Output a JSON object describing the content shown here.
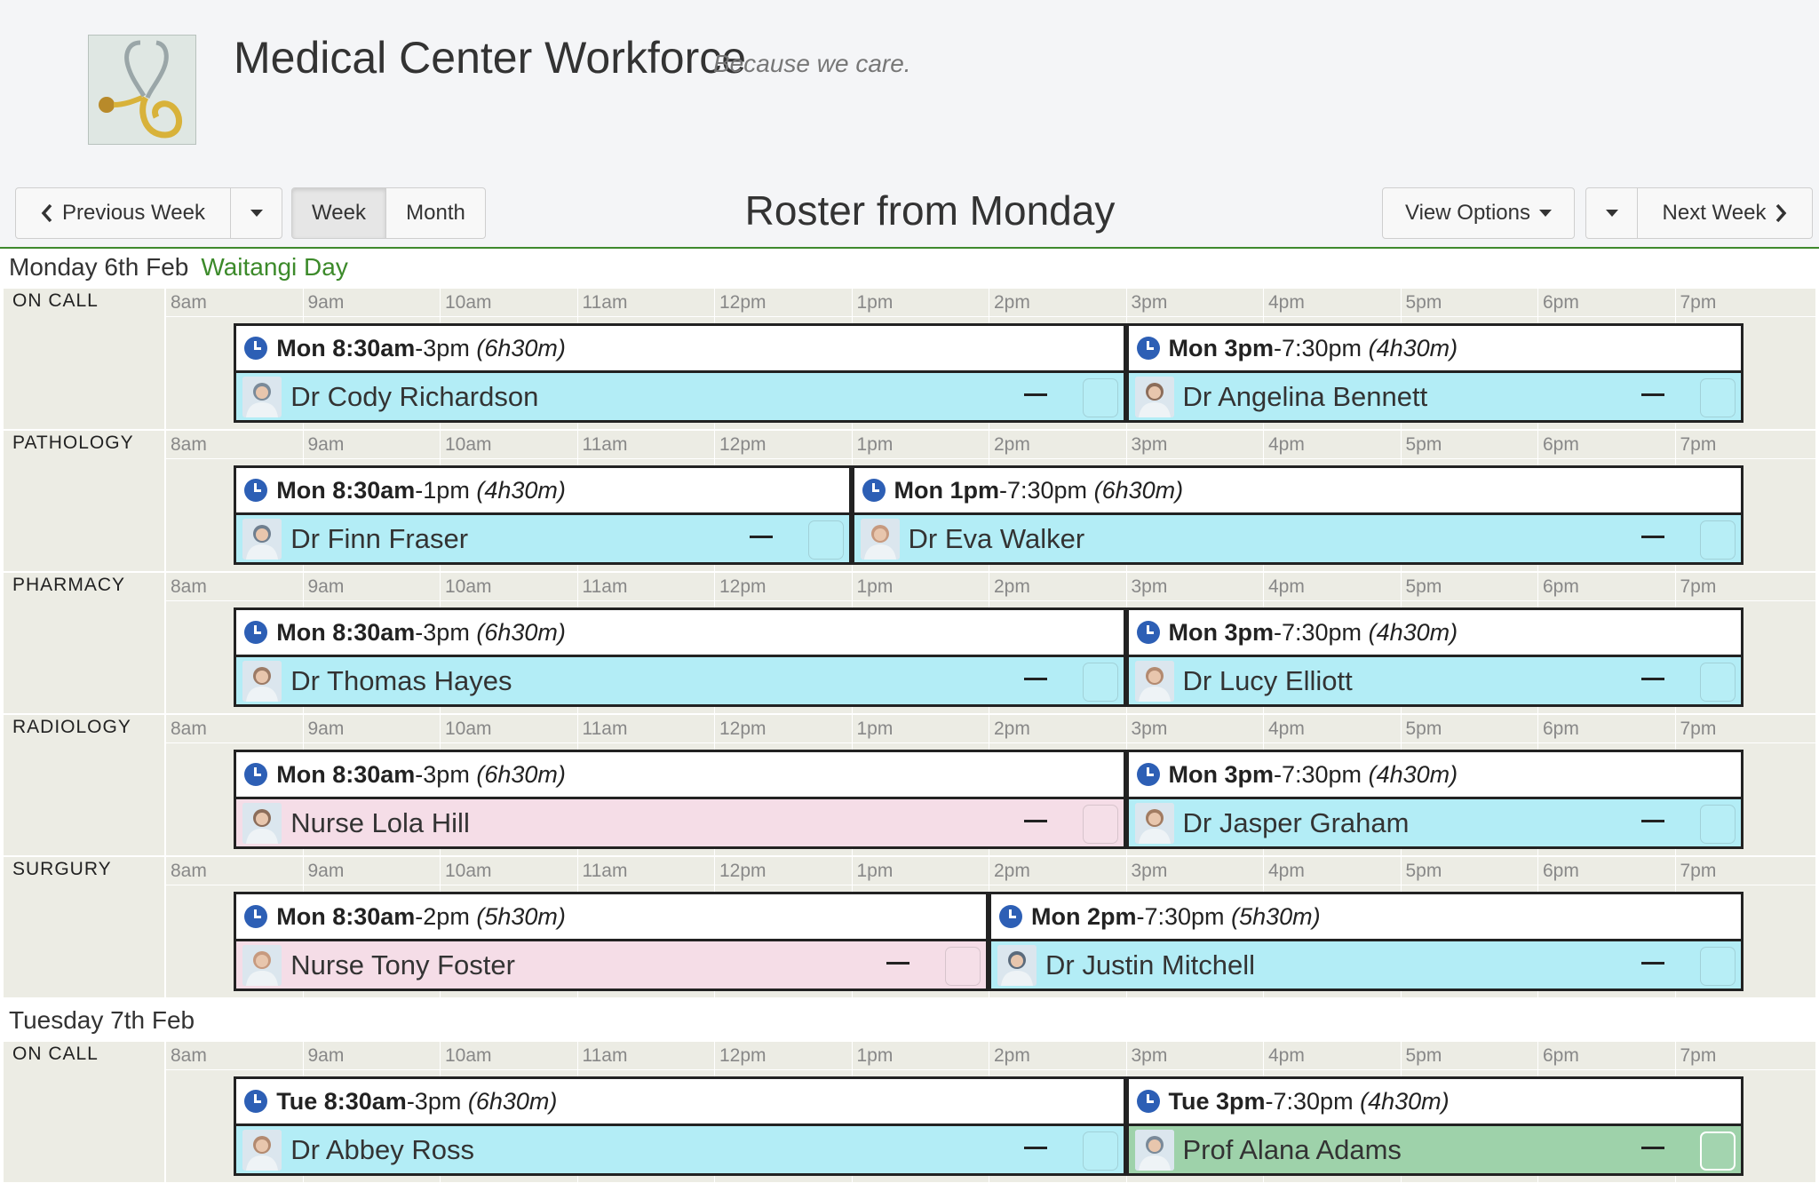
{
  "app": {
    "title": "Medical Center Workforce",
    "tagline": "Because we care."
  },
  "toolbar": {
    "prev_label": "Previous Week",
    "week_label": "Week",
    "month_label": "Month",
    "roster_title": "Roster from Monday",
    "view_options_label": "View Options",
    "next_label": "Next Week"
  },
  "colors": {
    "accent_green": "#3f8a2e",
    "doctor_cyan": "#b3edf6",
    "nurse_pink": "#f5dde7",
    "prof_green": "#9ed2aa",
    "clock_blue": "#2d5fb5"
  },
  "hours": [
    "8am",
    "9am",
    "10am",
    "11am",
    "12pm",
    "1pm",
    "2pm",
    "3pm",
    "4pm",
    "5pm",
    "6pm",
    "7pm"
  ],
  "days": [
    {
      "title": "Monday 6th Feb",
      "holiday": "Waitangi Day",
      "departments": [
        {
          "name": "ON CALL",
          "shifts": [
            {
              "start": "Mon 8:30am",
              "end": "-3pm",
              "duration": "(6h30m)",
              "person": "Dr Cody Richardson",
              "kind": "doctor"
            },
            {
              "start": "Mon 3pm",
              "end": "-7:30pm",
              "duration": "(4h30m)",
              "person": "Dr Angelina Bennett",
              "kind": "doctor"
            }
          ]
        },
        {
          "name": "PATHOLOGY",
          "shifts": [
            {
              "start": "Mon 8:30am",
              "end": "-1pm",
              "duration": "(4h30m)",
              "person": "Dr Finn Fraser",
              "kind": "doctor"
            },
            {
              "start": "Mon 1pm",
              "end": "-7:30pm",
              "duration": "(6h30m)",
              "person": "Dr Eva Walker",
              "kind": "doctor"
            }
          ]
        },
        {
          "name": "PHARMACY",
          "shifts": [
            {
              "start": "Mon 8:30am",
              "end": "-3pm",
              "duration": "(6h30m)",
              "person": "Dr Thomas Hayes",
              "kind": "doctor"
            },
            {
              "start": "Mon 3pm",
              "end": "-7:30pm",
              "duration": "(4h30m)",
              "person": "Dr Lucy Elliott",
              "kind": "doctor"
            }
          ]
        },
        {
          "name": "RADIOLOGY",
          "shifts": [
            {
              "start": "Mon 8:30am",
              "end": "-3pm",
              "duration": "(6h30m)",
              "person": "Nurse Lola Hill",
              "kind": "nurse"
            },
            {
              "start": "Mon 3pm",
              "end": "-7:30pm",
              "duration": "(4h30m)",
              "person": "Dr Jasper Graham",
              "kind": "doctor"
            }
          ]
        },
        {
          "name": "SURGURY",
          "shifts": [
            {
              "start": "Mon 8:30am",
              "end": "-2pm",
              "duration": "(5h30m)",
              "person": "Nurse Tony Foster",
              "kind": "nurse"
            },
            {
              "start": "Mon 2pm",
              "end": "-7:30pm",
              "duration": "(5h30m)",
              "person": "Dr Justin Mitchell",
              "kind": "doctor"
            }
          ]
        }
      ]
    },
    {
      "title": "Tuesday 7th Feb",
      "holiday": "",
      "departments": [
        {
          "name": "ON CALL",
          "shifts": [
            {
              "start": "Tue 8:30am",
              "end": "-3pm",
              "duration": "(6h30m)",
              "person": "Dr Abbey Ross",
              "kind": "doctor"
            },
            {
              "start": "Tue 3pm",
              "end": "-7:30pm",
              "duration": "(4h30m)",
              "person": "Prof Alana Adams",
              "kind": "prof"
            }
          ]
        }
      ]
    }
  ]
}
